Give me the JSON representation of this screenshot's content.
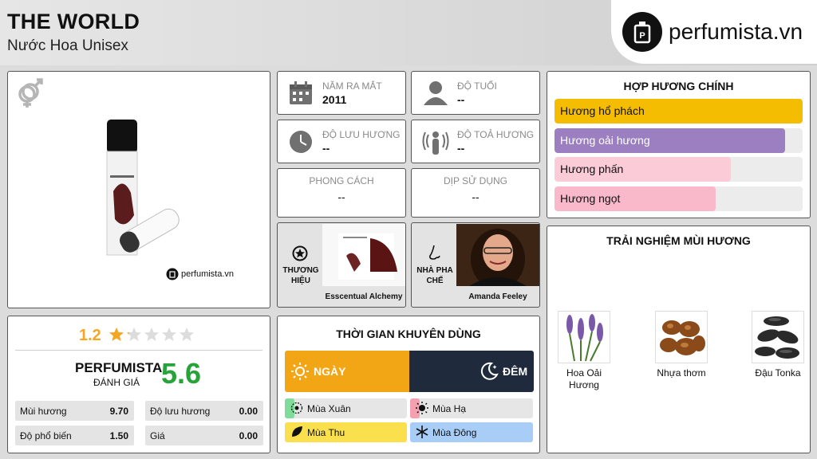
{
  "header": {
    "title": "THE WORLD",
    "subtitle": "Nước Hoa Unisex",
    "logo_text": "perfumista.vn"
  },
  "product": {
    "image_watermark": "perfumista.vn",
    "gender_icon": "unisex-gender-icon"
  },
  "info": {
    "release_label": "NĂM RA MẮT",
    "release_value": "2011",
    "age_label": "ĐỘ TUỔI",
    "age_value": "--",
    "longevity_label": "ĐỘ LƯU HƯƠNG",
    "longevity_value": "--",
    "sillage_label": "ĐỘ TOẢ HƯƠNG",
    "sillage_value": "--",
    "style_label": "PHONG CÁCH",
    "style_value": "--",
    "occasion_label": "DỊP SỬ DỤNG",
    "occasion_value": "--"
  },
  "brand": {
    "label": "THƯƠNG HIỆU",
    "name": "Esscentual Alchemy"
  },
  "perfumer": {
    "label": "NHÀ PHA CHẾ",
    "name": "Amanda Feeley"
  },
  "rating": {
    "user_score": "1.2",
    "stars_filled": 1.2,
    "stars_total": 5,
    "brand_label": "PERFUMISTA",
    "eval_label": "ĐÁNH GIÁ",
    "score": "5.6",
    "stats": [
      {
        "label": "Mùi hương",
        "value": "9.70"
      },
      {
        "label": "Độ lưu hương",
        "value": "0.00"
      },
      {
        "label": "Độ phổ biến",
        "value": "1.50"
      },
      {
        "label": "Giá",
        "value": "0.00"
      }
    ]
  },
  "time": {
    "title": "THỜI GIAN KHUYÊN DÙNG",
    "day_label": "NGÀY",
    "night_label": "ĐÊM",
    "seasons": [
      {
        "label": "Mùa Xuân",
        "color": "#7fdc9a",
        "level": 0.08
      },
      {
        "label": "Mùa Hạ",
        "color": "#f4a0b0",
        "level": 0.08
      },
      {
        "label": "Mùa Thu",
        "color": "#fbe04d",
        "level": 1.0
      },
      {
        "label": "Mùa Đông",
        "color": "#a8cdf7",
        "level": 1.0
      }
    ]
  },
  "accords": {
    "title": "HỢP HƯƠNG CHÍNH",
    "items": [
      {
        "label": "Hương hổ phách",
        "color": "#f5bd02",
        "level": 1.0,
        "text_color": "#111"
      },
      {
        "label": "Hương oải hương",
        "color": "#9b7fc0",
        "level": 0.93,
        "text_color": "#fff"
      },
      {
        "label": "Hương phấn",
        "color": "#fbcbd7",
        "level": 0.71,
        "text_color": "#111"
      },
      {
        "label": "Hương ngọt",
        "color": "#f9b9cb",
        "level": 0.65,
        "text_color": "#111"
      }
    ]
  },
  "notes": {
    "title": "TRẢI NGHIỆM MÙI HƯƠNG",
    "items": [
      {
        "label": "Hoa Oải Hương"
      },
      {
        "label": "Nhựa thơm"
      },
      {
        "label": "Đậu Tonka"
      }
    ]
  }
}
